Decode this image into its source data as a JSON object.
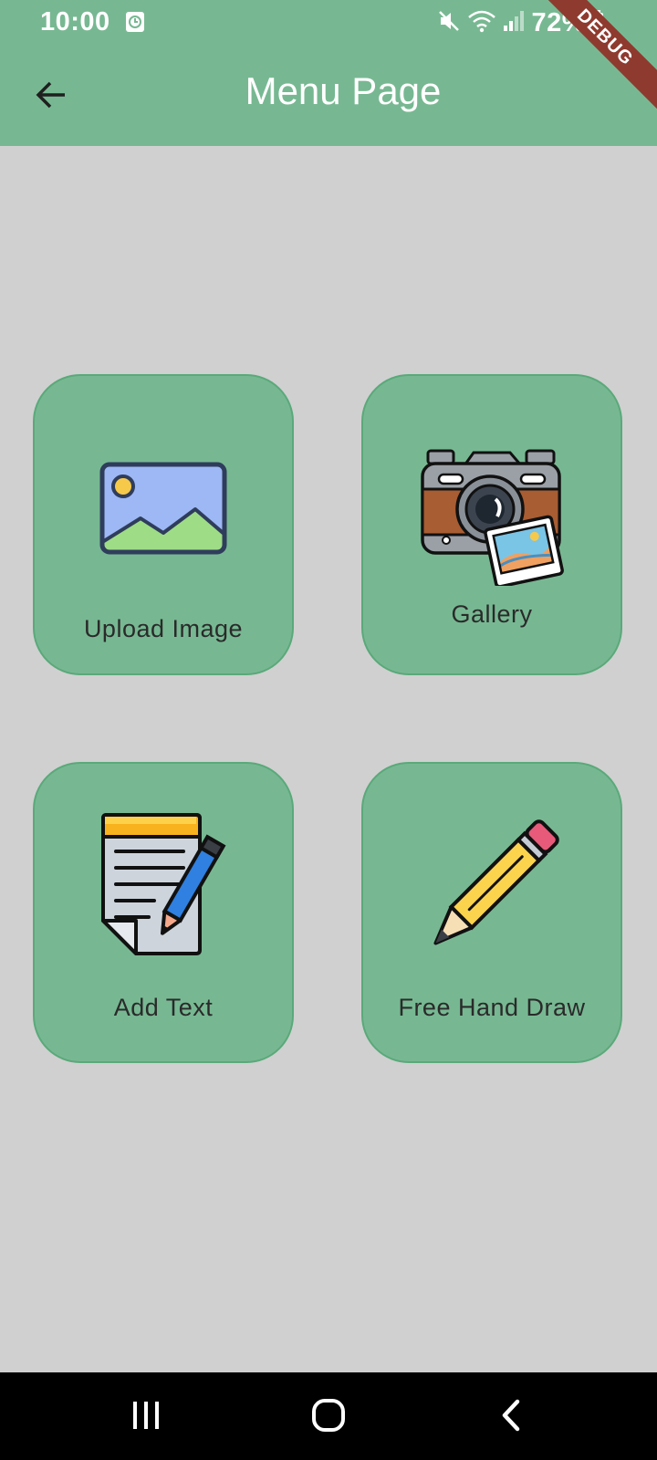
{
  "status_bar": {
    "time": "10:00",
    "battery": "72%",
    "icons": [
      "clock-widget-icon",
      "mute-icon",
      "wifi-icon",
      "signal-icon",
      "battery-icon"
    ]
  },
  "app_bar": {
    "title": "Menu Page",
    "back_icon": "arrow-back-icon",
    "debug_banner": "DEBUG"
  },
  "menu": {
    "items": [
      {
        "label": "Upload Image",
        "icon": "image-icon"
      },
      {
        "label": "Gallery",
        "icon": "camera-icon"
      },
      {
        "label": "Add Text",
        "icon": "notepad-icon"
      },
      {
        "label": "Free Hand Draw",
        "icon": "pencil-icon"
      }
    ]
  },
  "nav_bar": {
    "buttons": [
      "recents-icon",
      "home-icon",
      "back-icon"
    ]
  },
  "colors": {
    "app_bar": "#77b892",
    "background": "#d0d0d0",
    "card": "#77b892",
    "card_border": "#5aa97a",
    "debug_ribbon": "#8f3a2f"
  }
}
